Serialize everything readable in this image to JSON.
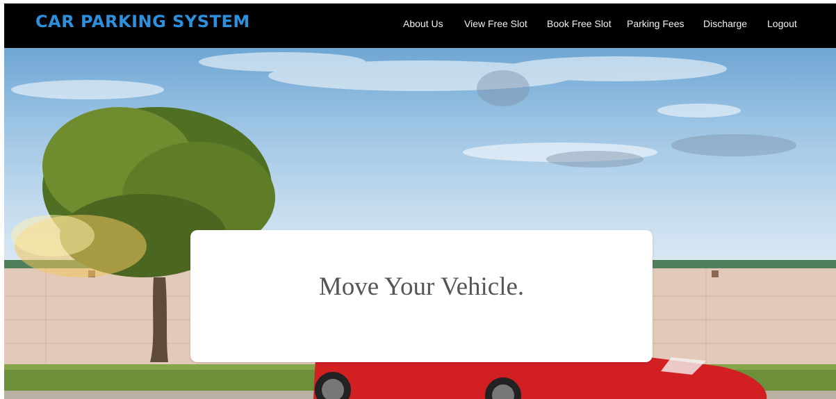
{
  "navbar": {
    "brand": "CAR PARKING SYSTEM",
    "links": [
      "About Us",
      "View Free Slot",
      "Book Free Slot",
      "Parking Fees",
      "Discharge",
      "Logout"
    ]
  },
  "hero": {
    "message": "Move Your Vehicle."
  },
  "colors": {
    "navbar_bg": "#000000",
    "brand": "#2e8fdc",
    "nav_text": "#f2f2f2",
    "card_bg": "#ffffff",
    "message_text": "#555555",
    "car_red": "#d11f22"
  }
}
